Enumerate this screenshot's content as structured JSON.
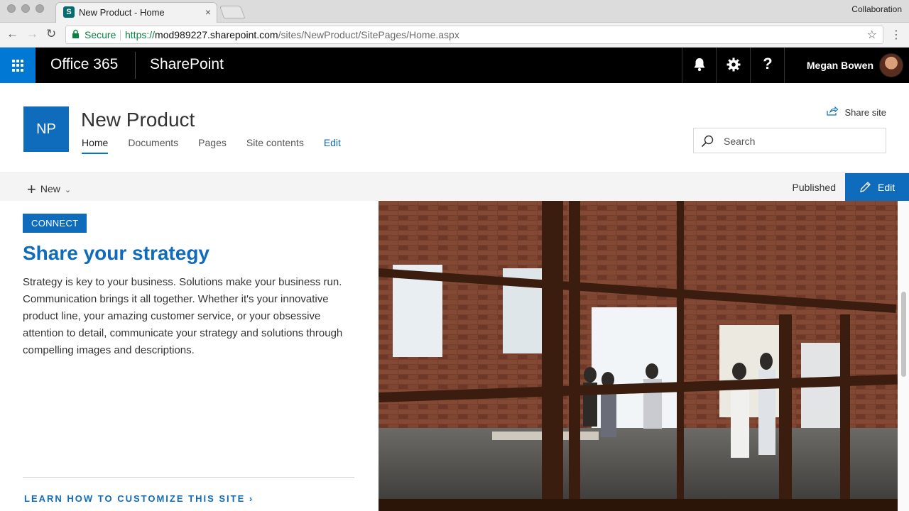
{
  "browser": {
    "tab_title": "New Product - Home",
    "tab_close": "×",
    "profile": "Collaboration",
    "secure_label": "Secure",
    "url_protocol": "https://",
    "url_host": "mod989227.sharepoint.com",
    "url_path": "/sites/NewProduct/SitePages/Home.aspx"
  },
  "suitebar": {
    "office_label": "Office 365",
    "app_label": "SharePoint",
    "help": "?",
    "user_name": "Megan Bowen"
  },
  "site": {
    "logo_initials": "NP",
    "title": "New Product",
    "nav": [
      "Home",
      "Documents",
      "Pages",
      "Site contents",
      "Edit"
    ],
    "share_label": "Share site",
    "search_placeholder": "Search"
  },
  "commandbar": {
    "new_label": "New",
    "status": "Published",
    "edit_label": "Edit"
  },
  "hero": {
    "tag": "CONNECT",
    "headline": "Share your strategy",
    "body": "Strategy is key to your business. Solutions make your business run. Communication brings it all together. Whether it's your innovative product line, your amazing customer service, or your obsessive attention to detail, communicate your strategy and solutions through compelling images and descriptions.",
    "learn_link": "LEARN HOW TO CUSTOMIZE THIS SITE"
  },
  "colors": {
    "accent": "#0f6cbd",
    "suitebar": "#000000",
    "waffle": "#0078d4"
  }
}
